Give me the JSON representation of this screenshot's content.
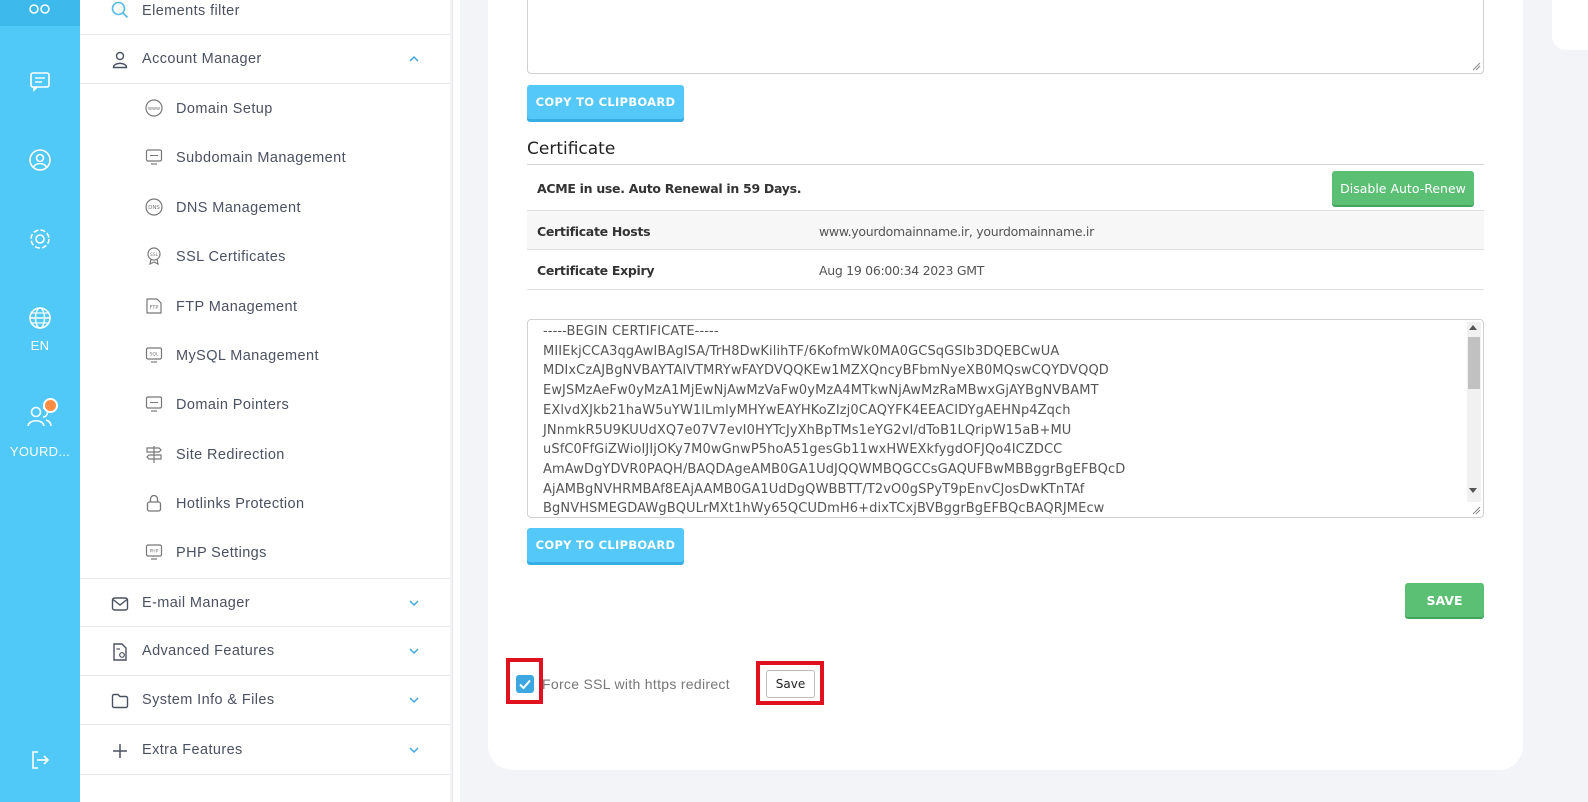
{
  "rail": {
    "language": "EN",
    "user": "YOURD..."
  },
  "menu": {
    "elements_filter": "Elements filter",
    "account_manager": "Account Manager",
    "subitems": [
      "Domain Setup",
      "Subdomain Management",
      "DNS Management",
      "SSL Certificates",
      "FTP Management",
      "MySQL Management",
      "Domain Pointers",
      "Site Redirection",
      "Hotlinks Protection",
      "PHP Settings"
    ],
    "email_manager": "E-mail Manager",
    "advanced_features": "Advanced Features",
    "system_info": "System Info & Files",
    "extra_features": "Extra Features"
  },
  "main": {
    "copy_label": "COPY TO CLIPBOARD",
    "certificate_heading": "Certificate",
    "acme_status": "ACME in use. Auto Renewal in 59 Days.",
    "disable_auto_renew": "Disable Auto-Renew",
    "hosts_label": "Certificate Hosts",
    "hosts_value": "www.yourdomainname.ir, yourdomainname.ir",
    "expiry_label": "Certificate Expiry",
    "expiry_value": "Aug 19 06:00:34 2023 GMT",
    "certificate_text": "-----BEGIN CERTIFICATE-----\nMIIEkjCCA3qgAwIBAgISA/TrH8DwKilihTF/6KofmWk0MA0GCSqGSIb3DQEBCwUA\nMDIxCzAJBgNVBAYTAlVTMRYwFAYDVQQKEw1MZXQncyBFbmNyeXB0MQswCQYDVQQD\nEwJSMzAeFw0yMzA1MjEwNjAwMzVaFw0yMzA4MTkwNjAwMzRaMBwxGjAYBgNVBAMT\nEXlvdXJkb21haW5uYW1lLmlyMHYwEAYHKoZIzj0CAQYFK4EEACIDYgAEHNp4Zqch\nJNnmkR5U9KUUdXQ7e07V7evI0HYTcJyXhBpTMs1eYG2vI/dToB1LQripW15aB+MU\nuSfC0FfGiZWioIJIjOKy7M0wGnwP5hoA51gesGb11wxHWEXkfygdOFJQo4ICZDCC\nAmAwDgYDVR0PAQH/BAQDAgeAMB0GA1UdJQQWMBQGCCsGAQUFBwMBBggrBgEFBQcD\nAjAMBgNVHRMBAf8EAjAAMB0GA1UdDgQWBBTT/T2vO0gSPyT9pEnvCJosDwKTnTAf\nBgNVHSMEGDAWgBQULrMXt1hWy65QCUDmH6+dixTCxjBVBggrBgEFBQcBAQRJMEcw",
    "save_label": "SAVE",
    "force_ssl_label": "Force SSL with https redirect",
    "small_save_label": "Save"
  }
}
